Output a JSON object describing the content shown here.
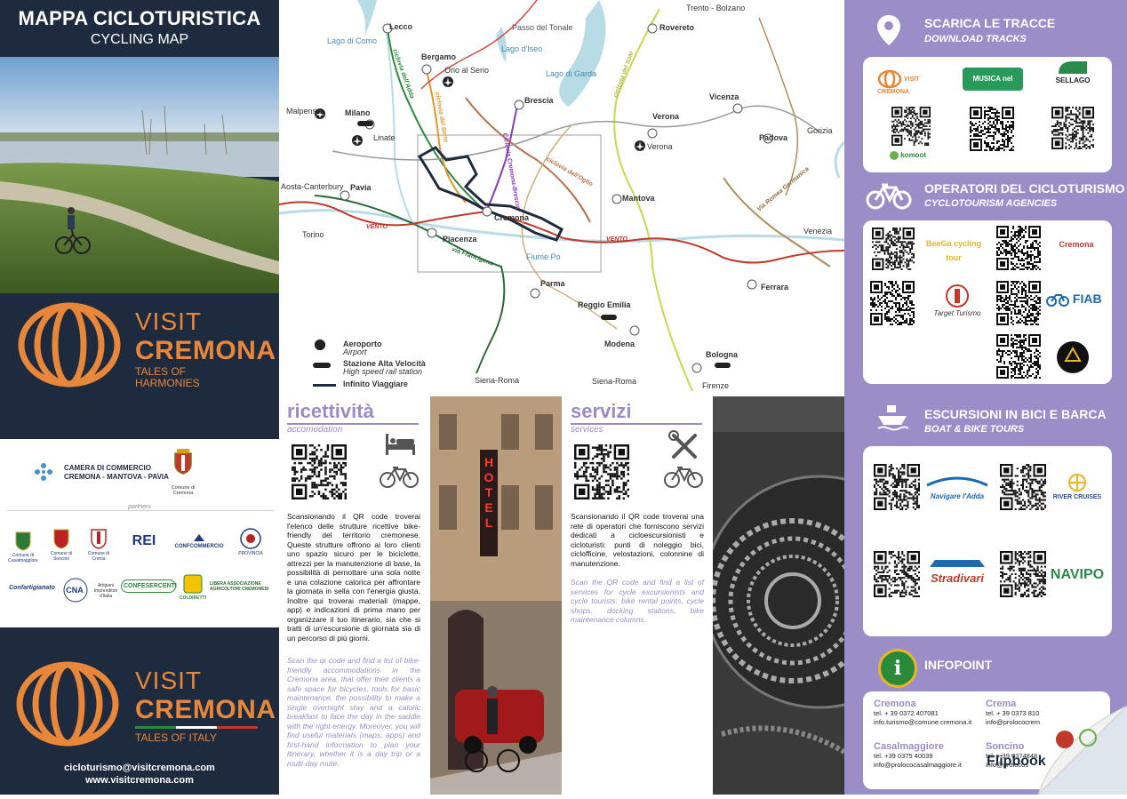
{
  "left": {
    "title": "MAPPA CICLOTURISTICA",
    "subtitle": "CYCLING MAP",
    "brand_top": {
      "visit": "VISIT",
      "name": "CREMONA",
      "tag1": "TALES OF",
      "tag2": "HARMONIES"
    },
    "chamber": {
      "line1": "CAMERA DI COMMERCIO",
      "line2": "CREMONA - MANTOVA - PAVIA",
      "comune": "Comune di Cremona"
    },
    "partners_label": "partners",
    "partner_logos": [
      "Comune di Casalmaggiore",
      "Comune di Soncino",
      "Comune di Crema",
      "REI",
      "CONFCOMMERCIO",
      "PROVINCIA",
      "Confartigianato",
      "CNA",
      "CONFESERCENTI",
      "COLDIRETTI",
      "LIBERA ASSOCIAZIONE AGRICOLTORI CREMONESI"
    ],
    "brand_bottom": {
      "visit": "VISIT",
      "name": "CREMONA",
      "tag": "TALES OF ITALY"
    },
    "email": "cicloturismo@visitcremona.com",
    "website": "www.visitcremona.com"
  },
  "map": {
    "cities": [
      "Lecco",
      "Bergamo",
      "Brescia",
      "Milano",
      "Pavia",
      "Piacenza",
      "Cremona",
      "Mantova",
      "Parma",
      "Reggio Emilia",
      "Modena",
      "Bologna",
      "Ferrara",
      "Padova",
      "Vicenza",
      "Verona",
      "Rovereto"
    ],
    "small_labels": [
      "Trento - Bolzano",
      "Passo del Tonale",
      "Lago di Como",
      "Lago d'Iseo",
      "Lago di Garda",
      "Orio al Serio",
      "Malpensa",
      "Linate",
      "Aosta-Canterbury",
      "Torino",
      "Venezia",
      "Gorizia",
      "Siena-Roma",
      "Firenze",
      "Fiume Po",
      "Verona"
    ],
    "routes": [
      "ciclovia dell'Adda",
      "ciclovia del Serio",
      "Ciclovia Cremona-Brescia",
      "ciclovia dell'Oglio",
      "ciclovia del Sole",
      "Via Romea Germanica",
      "via Francigena",
      "VENTO",
      "VENTO"
    ],
    "legend": [
      {
        "label": "Aeroporto",
        "sub": "Airport"
      },
      {
        "label": "Stazione Alta Velocità",
        "sub": "High speed rail station"
      },
      {
        "label": "Infinito Viaggiare",
        "sub": ""
      }
    ]
  },
  "ricettivita": {
    "title": "ricettività",
    "subtitle": "accomodation",
    "text_it": "Scansionando il QR code troverai l'elenco delle strutture ricettive bike-friendly del territorio cremonese. Queste strutture offrono ai loro clienti uno spazio sicuro per le biciclette, attrezzi per la manutenzione di base, la possibilità di pernottare una sola notte e una colazione calorica per affrontare la giornata in sella con l'energia giusta. Inoltre qui troverai materiali (mappe, app) e indicazioni di prima mano per organizzare il tuo itinerario, sia che si tratti di un'escursione di giornata sia di un percorso di più giorni.",
    "text_en": "Scan the qr code and find a list of bike-friendly accommodations in the Cremona area, that offer their clients a safe space for bicycles, tools for basic maintenance, the possibility to make a single overnight stay and a caloric breakfast to face the day in the saddle with the right energy. Moreover, you will find useful materials (maps, apps) and first-hand information to plan your itinerary, whether it is a day trip or a multi-day route.",
    "hotel_sign": "HOTEL"
  },
  "servizi": {
    "title": "servizi",
    "subtitle": "services",
    "text_it": "Scansionando il QR code troverai una rete di operatori che forniscono servizi dedicati a cicloescursionisti e cicloturisti: punti di noleggio bici, ciclofficine, velostazioni, colonnine di manutenzione.",
    "text_en": "Scan the QR code and find a list of services for cycle excursionists and cycle tourists: bike rental points, cycle shops, docking stations, bike maintenance columns."
  },
  "right": {
    "download": {
      "title": "SCARICA LE TRACCE",
      "sub": "DOWNLOAD TRACKS",
      "logos": [
        "VISIT CREMONA",
        "MUSICA nel vento",
        "SELLAGO",
        "komoot"
      ]
    },
    "agencies": {
      "title": "OPERATORI DEL CICLOTURISMO",
      "sub": "CYCLOTOURISM AGENCIES",
      "logos": [
        "BeeGa cycling tour",
        "Cremona",
        "Target Turismo",
        "FIAB"
      ]
    },
    "tours": {
      "title": "ESCURSIONI IN BICI E BARCA",
      "sub": "BOAT & BIKE TOURS",
      "logos": [
        "Navigare l'Adda",
        "RIVER CRUISES",
        "Stradivari",
        "NAVIPO"
      ]
    },
    "infopoint": {
      "title": "INFOPOINT",
      "entries": [
        {
          "name": "Cremona",
          "tel": "tel. + 39 0372 407081",
          "email": "info.turismo@comune.cremona.it"
        },
        {
          "name": "Crema",
          "tel": "tel. + 39 0373 810",
          "email": "info@prolococrem"
        },
        {
          "name": "Casalmaggiore",
          "tel": "tel. +39 0375 40039",
          "email": "info@prolococasalmaggiore.it"
        },
        {
          "name": "Soncino",
          "tel": "tel. + 39 0374848",
          "email": "info@prolocos"
        }
      ]
    },
    "flipbook_label": "Flipbook"
  },
  "colors": {
    "navy": "#1e2a3e",
    "orange": "#e8873a",
    "lavender": "#9b8dc8"
  }
}
